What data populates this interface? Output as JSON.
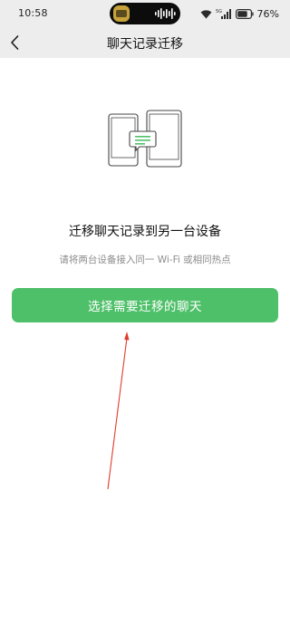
{
  "status_bar": {
    "time": "10:58",
    "battery_percent": "76%",
    "network_label": "5G",
    "icons": [
      "wifi-icon",
      "signal-icon",
      "battery-icon"
    ]
  },
  "header": {
    "title": "聊天记录迁移",
    "back_icon": "chevron-left-icon"
  },
  "main": {
    "illustration_icon": "phone-transfer-icon",
    "heading": "迁移聊天记录到另一台设备",
    "subtext": "请将两台设备接入同一 Wi-Fi 或相同热点",
    "action_button_label": "选择需要迁移的聊天"
  },
  "colors": {
    "accent": "#4fc06a",
    "nav_background": "#ededed",
    "annotation": "#e03b2e"
  }
}
